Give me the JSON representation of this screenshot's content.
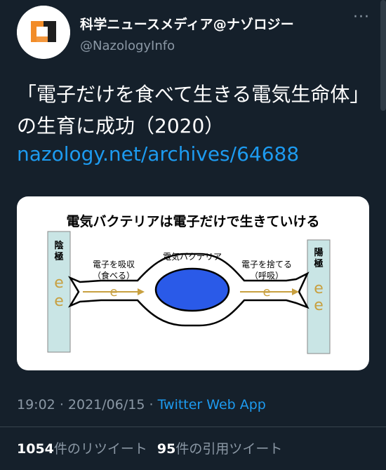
{
  "author": {
    "display_name": "科学ニュースメディア@ナゾロジー",
    "handle": "@NazologyInfo",
    "avatar_icon": "nazology-logo-icon"
  },
  "tweet": {
    "text": "「電子だけを食べて生きる電気生命体」の生育に成功（2020）",
    "link": "nazology.net/archives/64688"
  },
  "diagram": {
    "title": "電気バクテリアは電子だけで生きていける",
    "cathode": "陰極",
    "anode": "陽極",
    "bacteria_label": "電気バクテリア",
    "intake_label": "電子を吸収",
    "intake_sub": "（食べる）",
    "release_label": "電子を捨てる",
    "release_sub": "（呼吸）",
    "electron": "e"
  },
  "meta": {
    "time": "19:02",
    "date": "2021/06/15",
    "sep": "·",
    "source": "Twitter Web App"
  },
  "stats": {
    "retweets_count": "1054",
    "retweets_label": "件のリツイート",
    "quotes_count": "95",
    "quotes_label": "件の引用ツイート"
  },
  "colors": {
    "background": "#15202b",
    "link": "#1d9bf0",
    "secondary": "#8b98a5",
    "electron": "#c8a040",
    "bacteria": "#2a5ae8",
    "electrode": "#c9e5e5"
  }
}
